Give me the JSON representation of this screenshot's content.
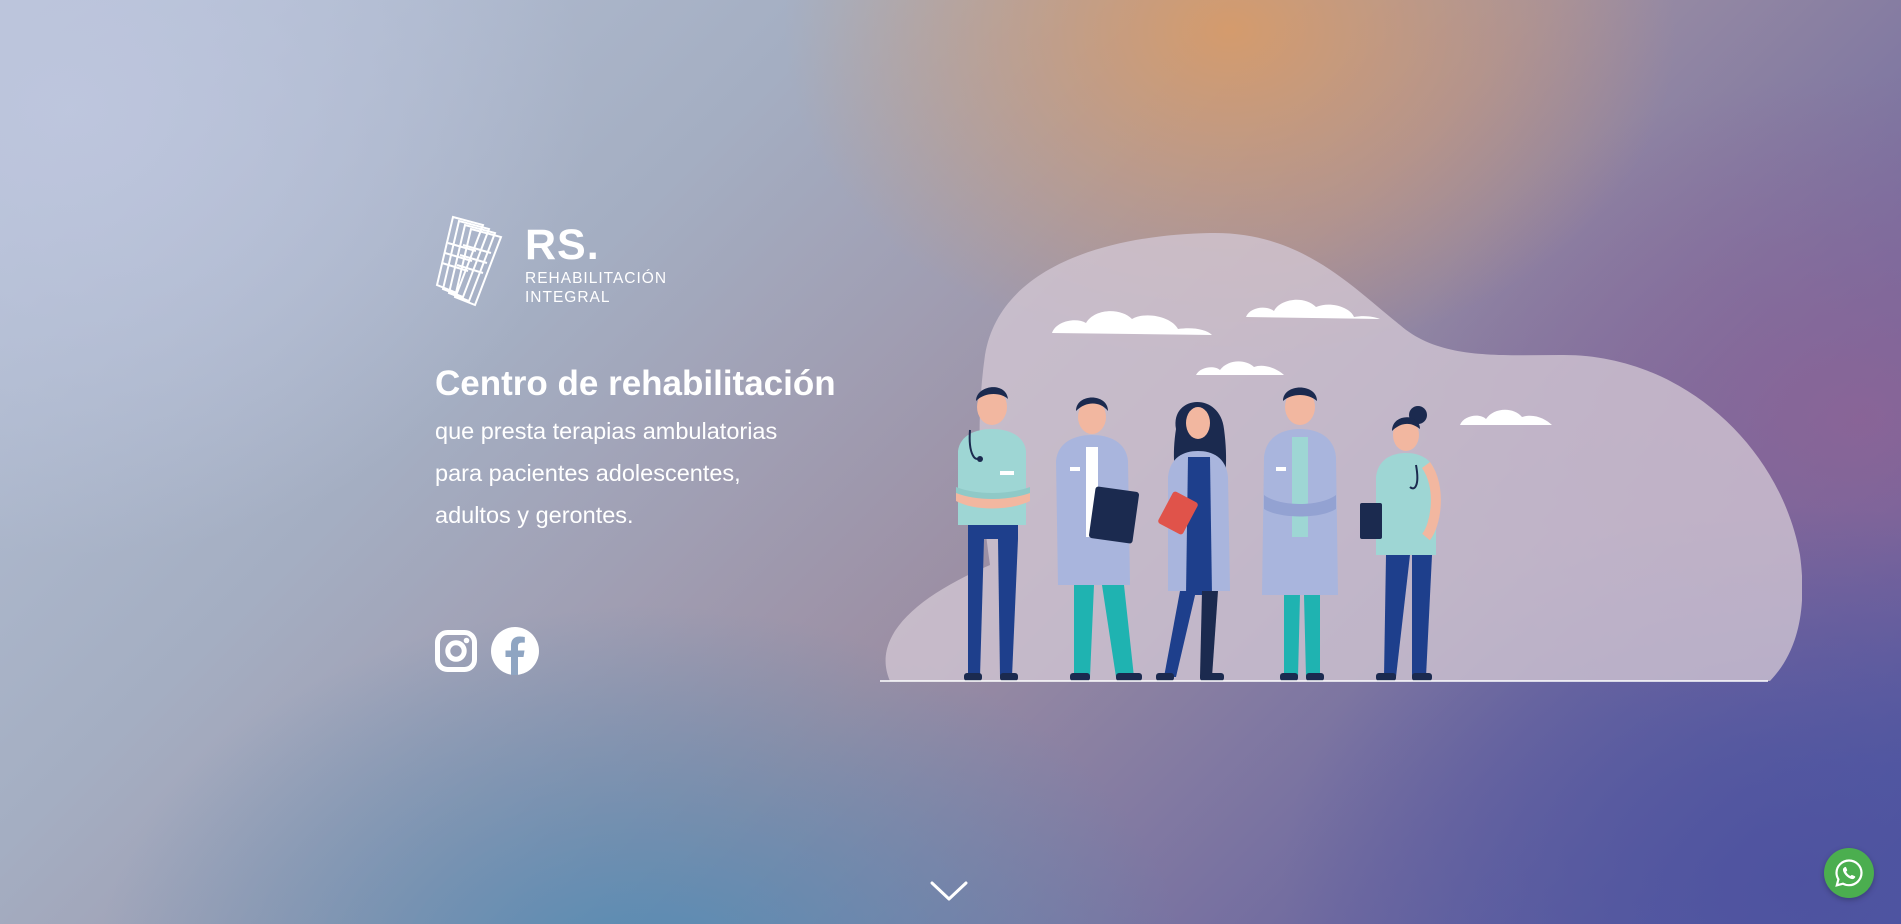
{
  "logo": {
    "name": "RS.",
    "subtitle_line1": "REHABILITACIÓN",
    "subtitle_line2": "INTEGRAL"
  },
  "hero": {
    "title": "Centro de rehabilitación",
    "description": "que presta terapias ambulatorias para pacientes adolescentes, adultos y gerontes."
  },
  "social": {
    "icons": [
      "instagram-icon",
      "facebook-icon"
    ]
  },
  "illustration": {
    "subject": "team of five medical staff in scrubs and lab coats",
    "icons": [
      "cloud",
      "stethoscope",
      "clipboard"
    ]
  },
  "scroll": {
    "icon": "chevron-down-icon"
  },
  "whatsapp": {
    "icon": "whatsapp-icon"
  },
  "colors": {
    "text": "#ffffff",
    "blob": "#d2c6d3",
    "scrub_teal": "#9ed6d4",
    "pants_navy": "#1e3f8c",
    "coat_lavender": "#a9b5dd",
    "pants_teal": "#1fb3b1",
    "accent_red": "#e0534a",
    "whatsapp_green": "#4bae4f"
  }
}
